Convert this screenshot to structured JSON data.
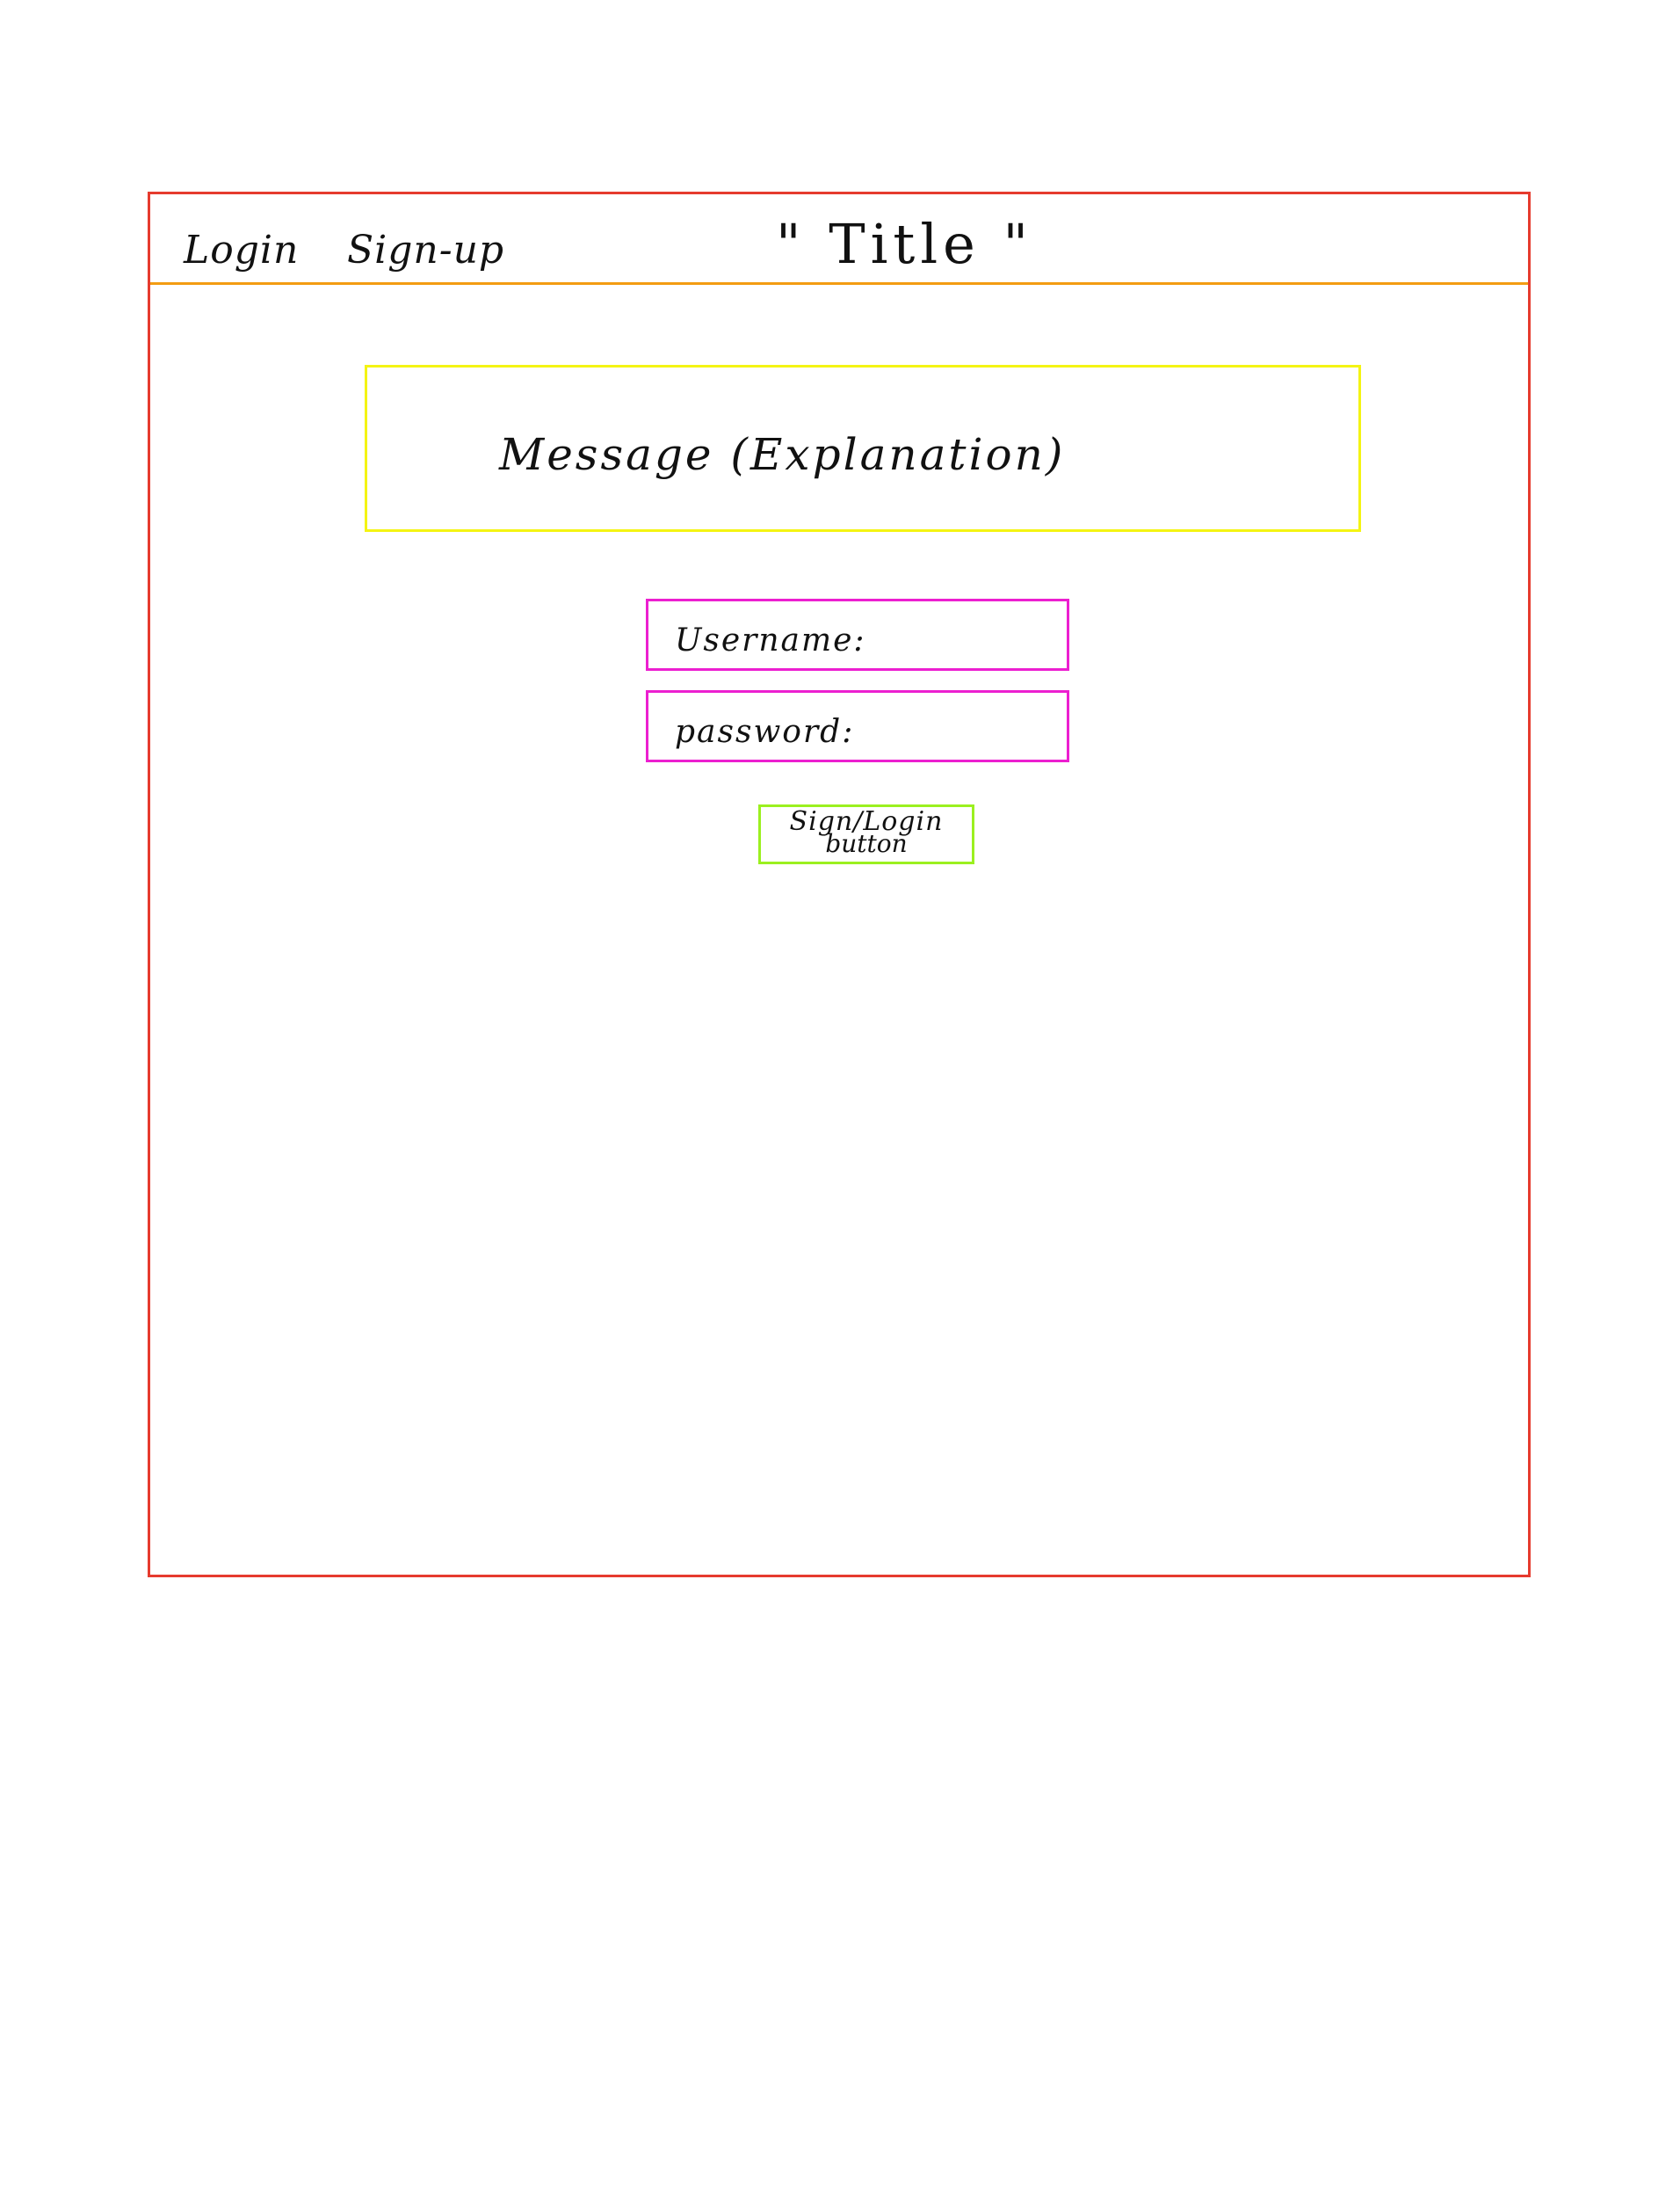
{
  "header": {
    "nav": {
      "login": "Login",
      "signup": "Sign-up"
    },
    "title": "\" Title \""
  },
  "message": {
    "text": "Message (Explanation)"
  },
  "form": {
    "username_label": "Username:",
    "password_label": "password:",
    "submit_label": "Sign/Login",
    "submit_sub": "button"
  },
  "colors": {
    "frame": "#e63b2e",
    "header_divider": "#f39c12",
    "message_box": "#f4f413",
    "field_border": "#ec1fd0",
    "button_border": "#9bf01f"
  }
}
